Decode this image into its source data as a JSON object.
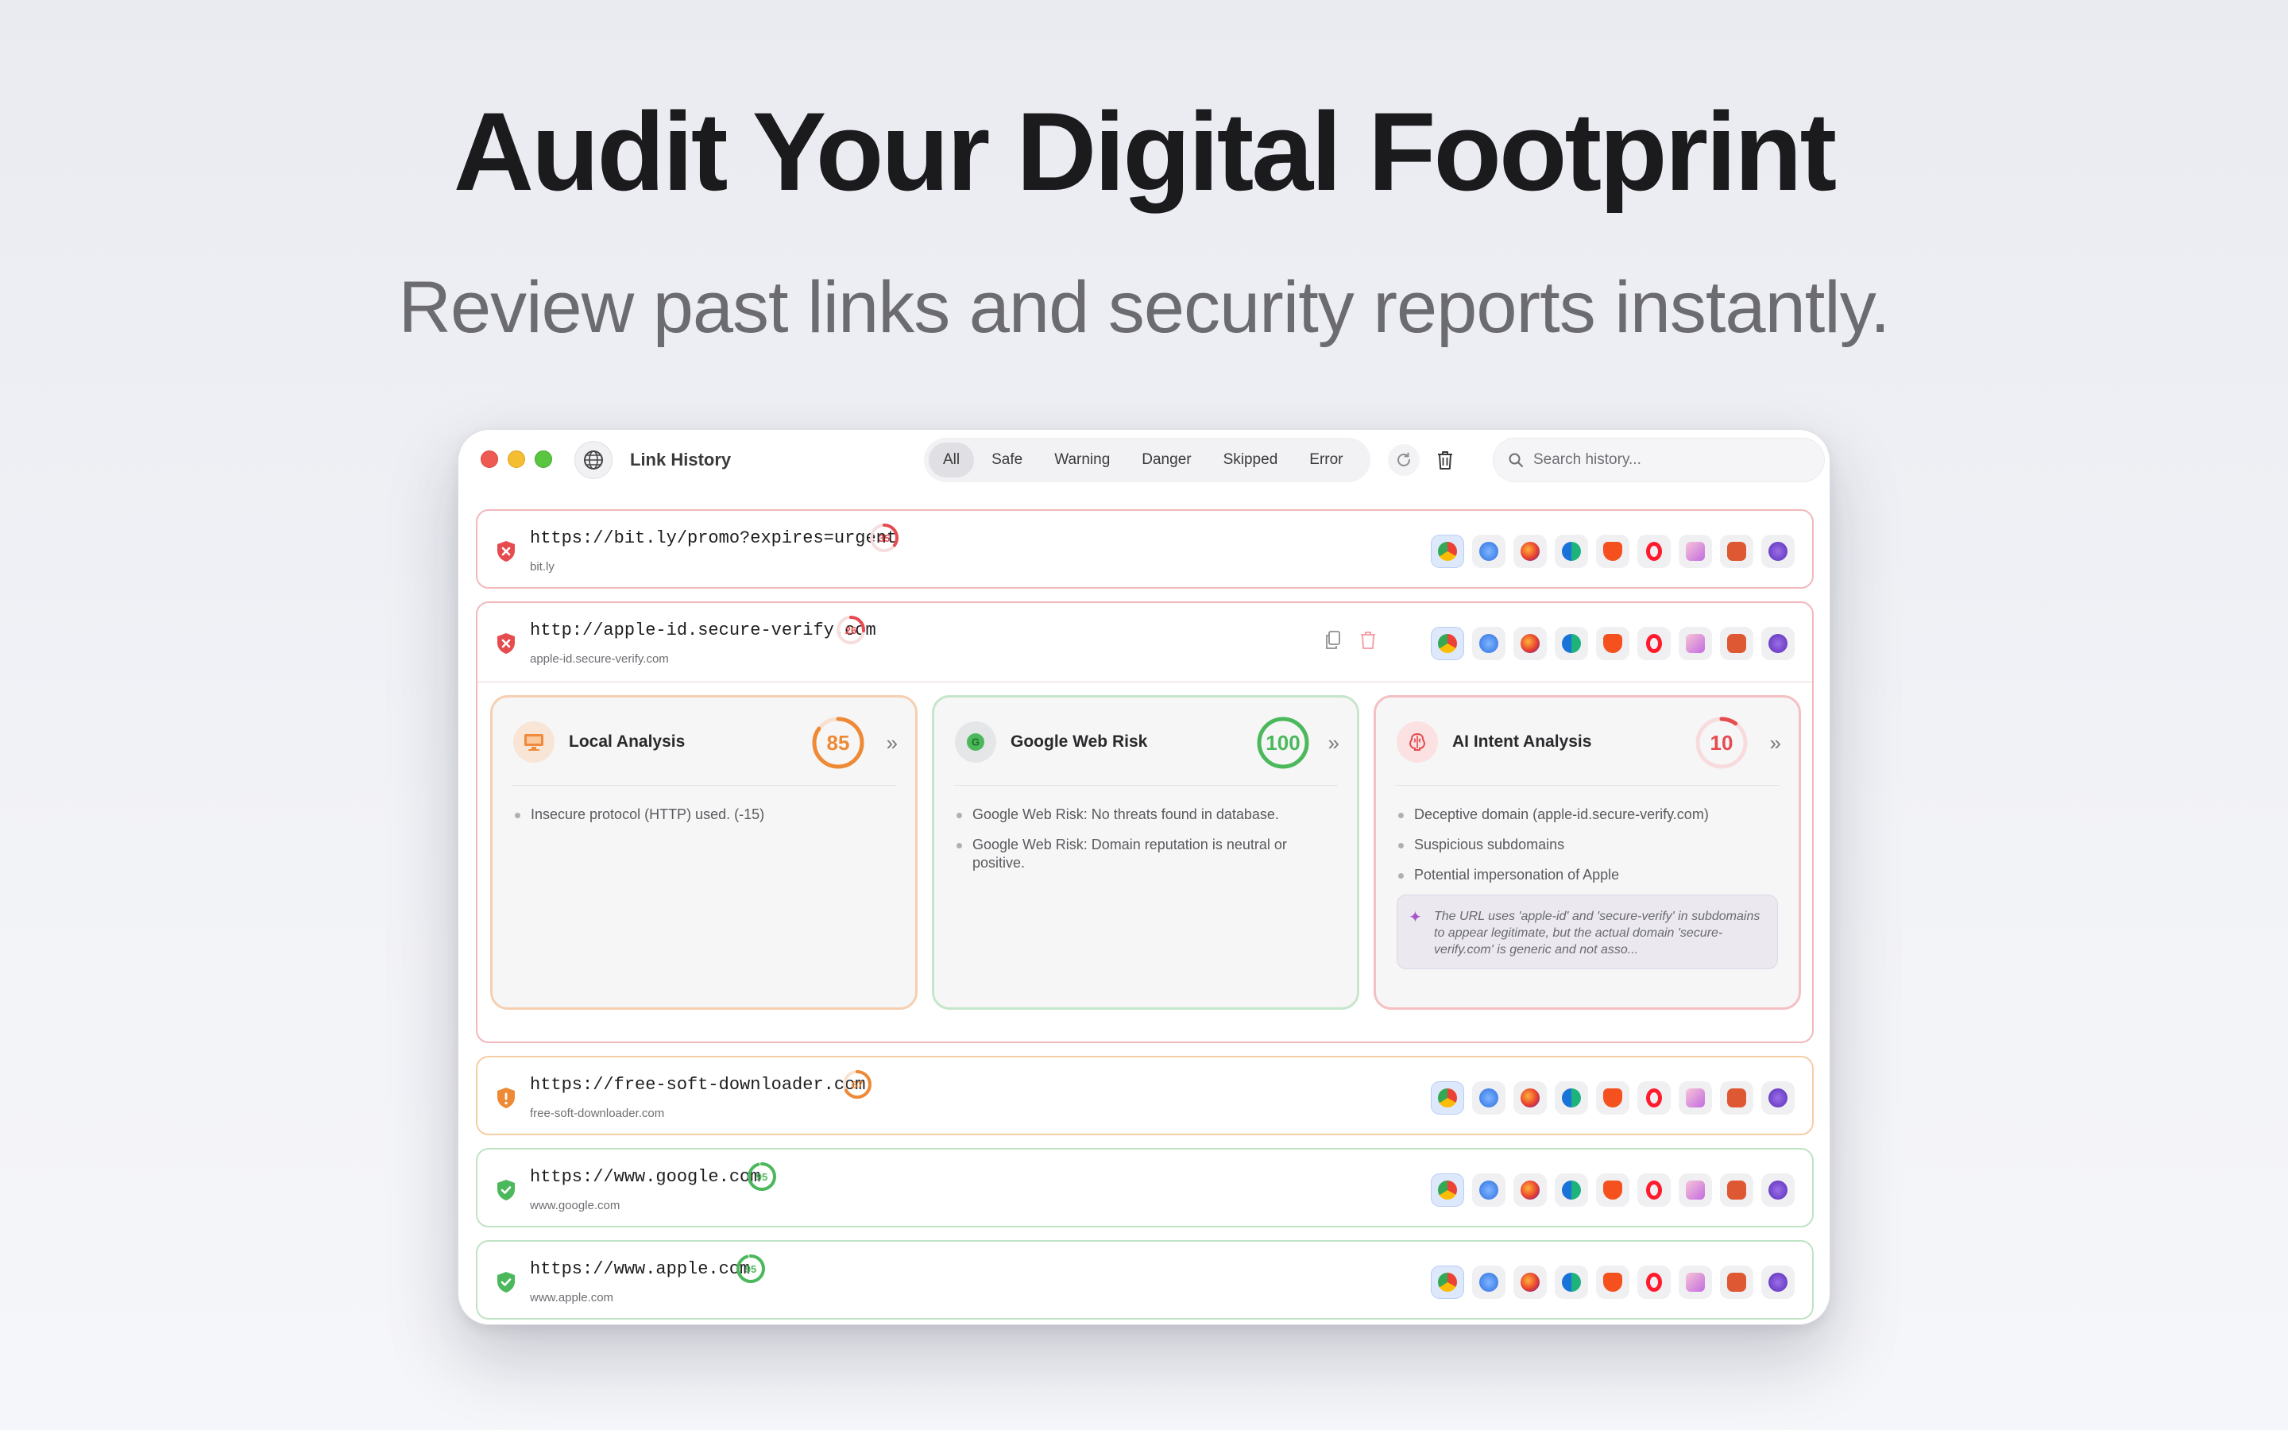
{
  "hero": {
    "title": "Audit Your Digital Footprint",
    "subtitle": "Review past links and security reports instantly."
  },
  "window": {
    "title": "Link History",
    "filters": [
      "All",
      "Safe",
      "Warning",
      "Danger",
      "Skipped",
      "Error"
    ],
    "active_filter": "All",
    "search_placeholder": "Search history..."
  },
  "browsers": [
    "chrome-icon",
    "safari-icon",
    "firefox-icon",
    "edge-icon",
    "brave-icon",
    "opera-icon",
    "arc-icon",
    "duckduckgo-icon",
    "tor-icon"
  ],
  "colors": {
    "danger": "#e54b4f",
    "warning": "#ee8a35",
    "safe": "#4cb85c",
    "accent": "#3b82f6"
  },
  "rows": [
    {
      "url": "https://bit.ly/promo?expires=urgent",
      "domain": "bit.ly",
      "score": "35",
      "status": "danger"
    },
    {
      "url": "http://apple-id.secure-verify.com",
      "domain": "apple-id.secure-verify.com",
      "score": "26",
      "status": "danger",
      "expanded": true
    },
    {
      "url": "https://free-soft-downloader.com",
      "domain": "free-soft-downloader.com",
      "score": "67",
      "status": "warning"
    },
    {
      "url": "https://www.google.com",
      "domain": "www.google.com",
      "score": "95",
      "status": "safe"
    },
    {
      "url": "https://www.apple.com",
      "domain": "www.apple.com",
      "score": "95",
      "status": "safe"
    }
  ],
  "details": {
    "local": {
      "title": "Local Analysis",
      "score": "85",
      "findings": [
        "Insecure protocol (HTTP) used. (-15)"
      ]
    },
    "google": {
      "title": "Google Web Risk",
      "score": "100",
      "icon_letter": "G",
      "findings": [
        "Google Web Risk: No threats found in database.",
        "Google Web Risk: Domain reputation is neutral or positive."
      ]
    },
    "ai": {
      "title": "AI Intent Analysis",
      "score": "10",
      "findings": [
        "Deceptive domain (apple-id.secure-verify.com)",
        "Suspicious subdomains",
        "Potential impersonation of Apple"
      ],
      "summary": "The URL uses 'apple-id' and 'secure-verify' in subdomains to appear legitimate, but the actual domain 'secure-verify.com' is generic and not asso..."
    }
  }
}
